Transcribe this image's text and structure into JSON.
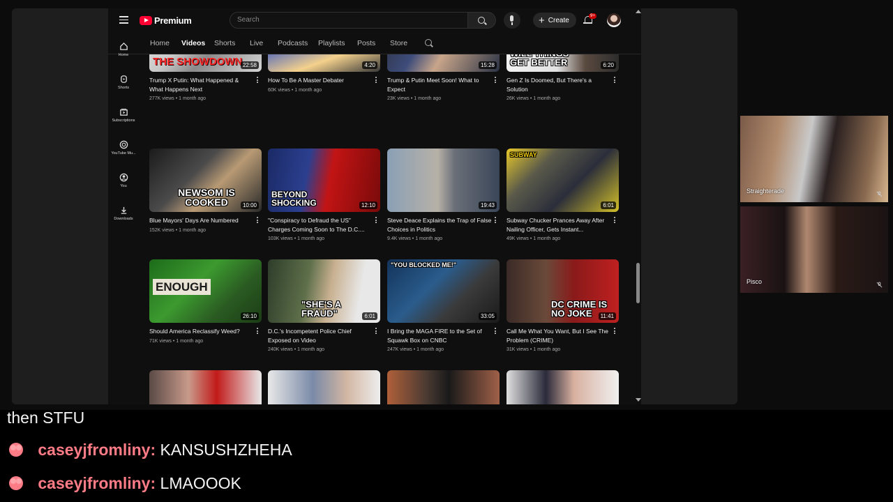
{
  "youtube": {
    "logo_text": "Premium",
    "search": {
      "placeholder": "Search"
    },
    "create_label": "Create",
    "notification_badge": "9+",
    "tabs": [
      {
        "label": "Home",
        "active": false
      },
      {
        "label": "Videos",
        "active": true
      },
      {
        "label": "Shorts",
        "active": false
      },
      {
        "label": "Live",
        "active": false
      },
      {
        "label": "Podcasts",
        "active": false
      },
      {
        "label": "Playlists",
        "active": false
      },
      {
        "label": "Posts",
        "active": false
      },
      {
        "label": "Store",
        "active": false
      }
    ],
    "guide": [
      {
        "label": "Home",
        "icon": "home-icon"
      },
      {
        "label": "Shorts",
        "icon": "shorts-icon"
      },
      {
        "label": "Subscriptions",
        "icon": "subscriptions-icon"
      },
      {
        "label": "YouTube Mu...",
        "icon": "youtube-music-icon"
      },
      {
        "label": "You",
        "icon": "you-icon"
      },
      {
        "label": "Downloads",
        "icon": "download-icon"
      }
    ],
    "videos": [
      {
        "title": "Trump X Putin: What Happened & What Happens Next",
        "views": "277K views",
        "age": "1 month ago",
        "duration": "22:58",
        "thumb_text": "THE SHOWDOWN"
      },
      {
        "title": "How To Be A Master Debater",
        "views": "60K views",
        "age": "1 month ago",
        "duration": "4:20",
        "thumb_text": ""
      },
      {
        "title": "Trump & Putin Meet Soon! What to Expect",
        "views": "23K views",
        "age": "1 month ago",
        "duration": "15:28",
        "thumb_text": ""
      },
      {
        "title": "Gen Z Is Doomed, But There's a Solution",
        "views": "26K views",
        "age": "1 month ago",
        "duration": "6:20",
        "thumb_text": "WILL THINGS GET BETTER"
      },
      {
        "title": "Blue Mayors' Days Are Numbered",
        "views": "152K views",
        "age": "1 month ago",
        "duration": "10:00",
        "thumb_text": "NEWSOM IS COOKED"
      },
      {
        "title": "\"Conspiracy to Defraud the US\" Charges Coming Soon to The D.C....",
        "views": "103K views",
        "age": "1 month ago",
        "duration": "12:10",
        "thumb_text": "BEYOND SHOCKING"
      },
      {
        "title": "Steve Deace Explains the Trap of False Choices in Politics",
        "views": "9.4K views",
        "age": "1 month ago",
        "duration": "19:43",
        "thumb_text": ""
      },
      {
        "title": "Subway Chucker Prances Away After Nailing Officer, Gets Instant...",
        "views": "49K views",
        "age": "1 month ago",
        "duration": "6:01",
        "thumb_text": "SUBWAY"
      },
      {
        "title": "Should America Reclassify Weed?",
        "views": "71K views",
        "age": "1 month ago",
        "duration": "26:10",
        "thumb_text": "ENOUGH"
      },
      {
        "title": "D.C.'s Incompetent Police Chief Exposed on Video",
        "views": "240K views",
        "age": "1 month ago",
        "duration": "6:01",
        "thumb_text": "\"SHE'S A FRAUD\""
      },
      {
        "title": "I Bring the MAGA FIRE to the Set of Squawk Box on CNBC",
        "views": "247K views",
        "age": "1 month ago",
        "duration": "33:05",
        "thumb_text": "\"YOU BLOCKED ME!\""
      },
      {
        "title": "Call Me What You Want, But I See The Problem (CRIME)",
        "views": "31K views",
        "age": "1 month ago",
        "duration": "11:41",
        "thumb_text": "DC CRIME IS NO JOKE"
      }
    ]
  },
  "cams": [
    {
      "name": "Straighterade"
    },
    {
      "name": "Pisco"
    }
  ],
  "chat": [
    {
      "user": "",
      "message": "then STFU"
    },
    {
      "user": "caseyjfromliny:",
      "message": "KANSUSHZHEHA"
    },
    {
      "user": "caseyjfromliny:",
      "message": "LMAOOOK"
    }
  ],
  "colors": {
    "accent_red": "#ff0033",
    "chat_user": "#ff7b86",
    "background": "#0f0f0f"
  }
}
